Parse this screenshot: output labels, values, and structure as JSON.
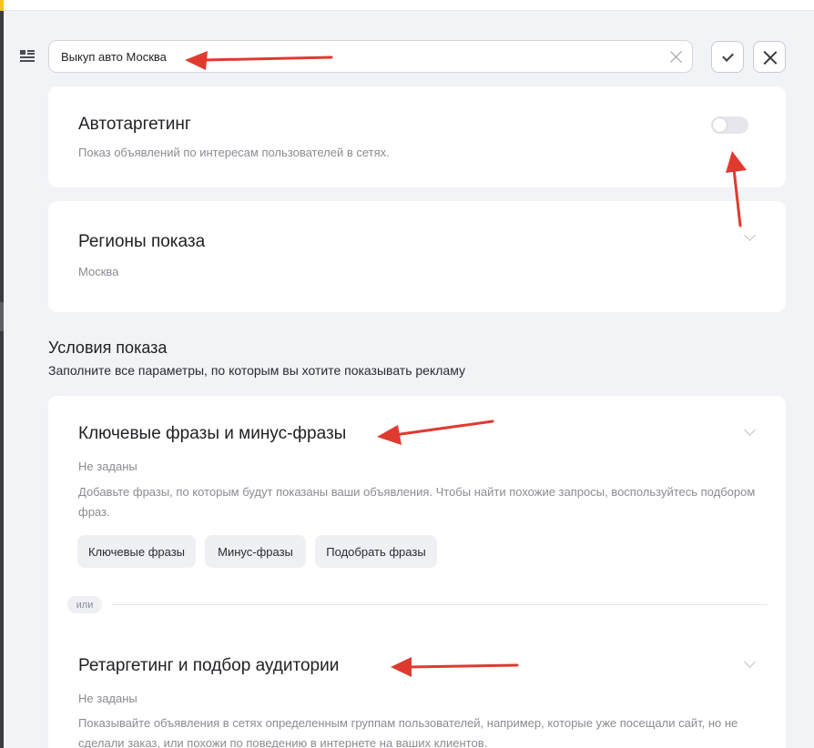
{
  "header": {
    "group_name_value": "Выкуп авто Москва",
    "confirm_label": "",
    "cancel_label": ""
  },
  "autotargeting": {
    "title": "Автотаргетинг",
    "description": "Показ объявлений по интересам пользователей в сетях.",
    "enabled": false
  },
  "regions": {
    "title": "Регионы показа",
    "value": "Москва"
  },
  "conditions": {
    "title": "Условия показа",
    "subtitle": "Заполните все параметры, по которым вы хотите показывать рекламу",
    "keywords": {
      "title": "Ключевые фразы и минус-фразы",
      "status": "Не заданы",
      "description": "Добавьте фразы, по которым будут показаны ваши объявления. Чтобы найти похожие запросы, воспользуйтесь подбором фраз.",
      "buttons": [
        "Ключевые фразы",
        "Минус-фразы",
        "Подобрать фразы"
      ]
    },
    "or_label": "или",
    "retargeting": {
      "title": "Ретаргетинг и подбор аудитории",
      "status": "Не заданы",
      "description": "Показывайте объявления в сетях определенным группам пользователей, например, которые уже посещали сайт, но не сделали заказ, или похожи по поведению в интернете на ваших клиентов."
    }
  },
  "colors": {
    "annotation_arrow": "#e03a2f",
    "background": "#f2f3f7",
    "card": "#ffffff"
  }
}
